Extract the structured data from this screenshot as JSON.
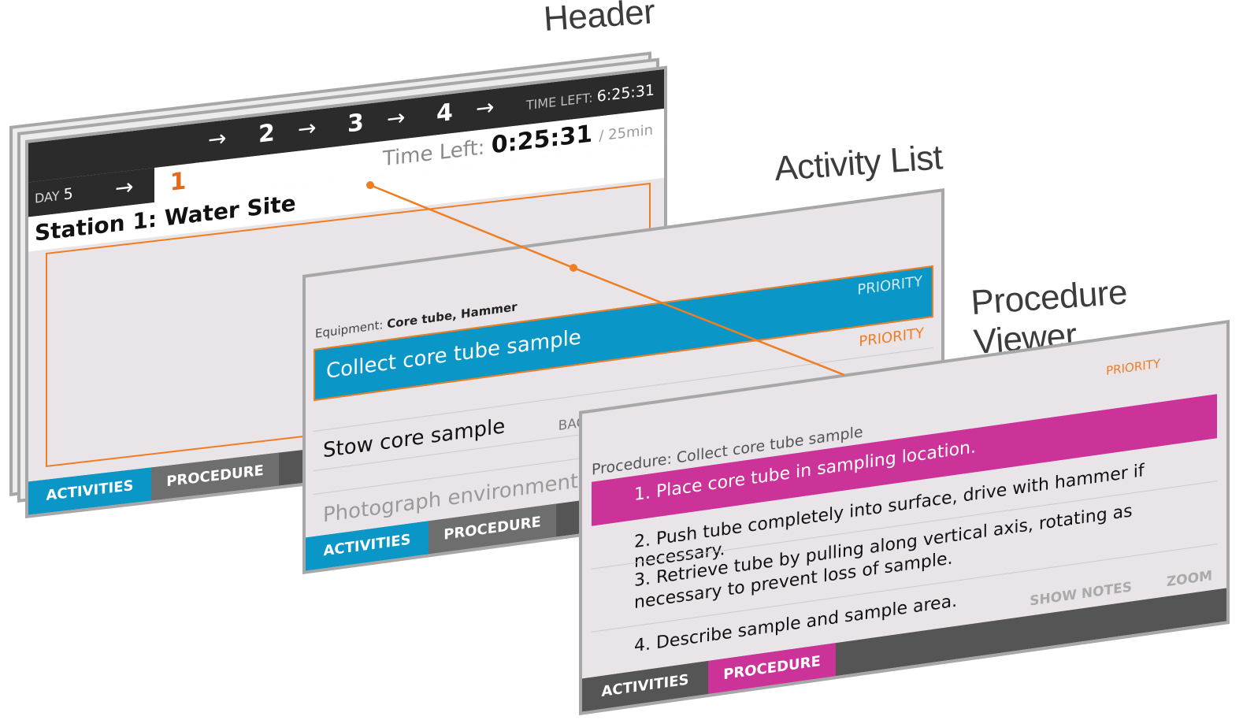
{
  "annotations": {
    "header": "Header",
    "activity_list": "Activity List",
    "procedure_viewer": "Procedure Viewer"
  },
  "header_panel": {
    "day_label": "DAY",
    "day_value": "5",
    "steps": [
      "1",
      "2",
      "3",
      "4"
    ],
    "active_step": "1",
    "arrow": "→",
    "time_left_label": "TIME LEFT:",
    "time_left_value": "6:25:31",
    "station_time_label": "Time Left:",
    "station_time_value": "0:25:31",
    "station_time_total": "/ 25min",
    "station_title": "Station 1: Water Site",
    "tabs": {
      "activities": "ACTIVITIES",
      "procedure": "PROCEDURE"
    }
  },
  "activity_panel": {
    "equipment_label": "Equipment:",
    "equipment_value": "Core tube, Hammer",
    "selected_priority": "PRIORITY",
    "items": [
      {
        "label": "Collect core tube sample",
        "tag": ""
      },
      {
        "label": "Stow core sample",
        "tag": "PRIORITY"
      }
    ],
    "backup_header": "BACKUP ACTIVITIES",
    "backup_items": [
      "Photograph environment"
    ],
    "tabs": {
      "activities": "ACTIVITIES",
      "procedure": "PROCEDURE"
    }
  },
  "procedure_panel": {
    "priority": "PRIORITY",
    "title": "Procedure: Collect core tube sample",
    "steps": [
      "1. Place core tube in sampling location.",
      "2. Push tube completely into surface, drive with hammer if necessary.",
      "3. Retrieve tube by pulling along vertical axis, rotating as necessary to prevent loss of sample.",
      "4. Describe sample and sample area."
    ],
    "utility_buttons": {
      "show_notes": "SHOW NOTES",
      "zoom": "ZOOM"
    },
    "tabs": {
      "activities": "ACTIVITIES",
      "procedure": "PROCEDURE"
    }
  },
  "colors": {
    "orange_accent": "#ef7d22",
    "activities_blue": "#0a97c8",
    "procedure_magenta": "#cc3399",
    "dark_bar": "#2b2b2b",
    "panel_bg": "#e9e4e7"
  }
}
